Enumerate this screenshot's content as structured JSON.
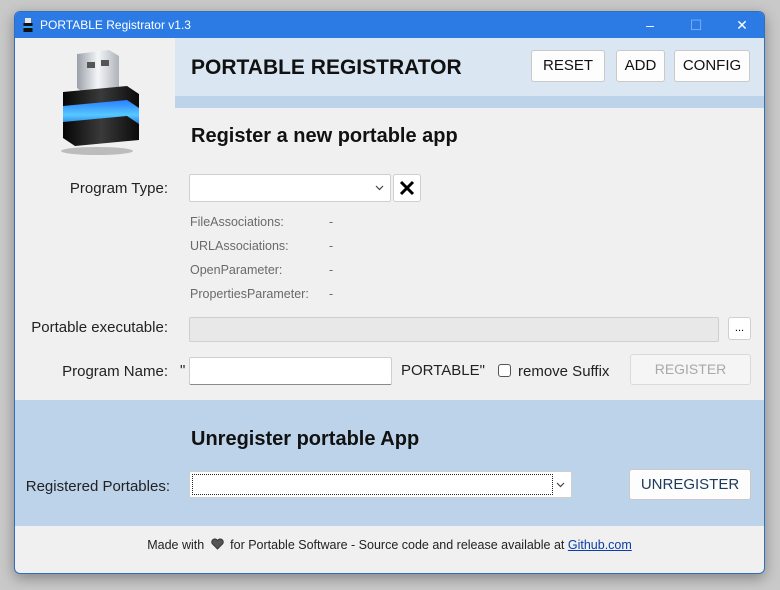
{
  "window": {
    "title": "PORTABLE Registrator v1.3",
    "controls": {
      "minimize": "–",
      "maximize": "☐",
      "close": "✕"
    }
  },
  "header": {
    "title": "PORTABLE REGISTRATOR",
    "buttons": {
      "reset": "RESET",
      "add": "ADD",
      "config": "CONFIG"
    }
  },
  "register": {
    "title": "Register a new portable app",
    "program_type": {
      "label": "Program Type:",
      "selected": ""
    },
    "associations": [
      {
        "key": "FileAssociations:",
        "value": "-"
      },
      {
        "key": "URLAssociations:",
        "value": "-"
      },
      {
        "key": "OpenParameter:",
        "value": "-"
      },
      {
        "key": "PropertiesParameter:",
        "value": "-"
      }
    ],
    "executable": {
      "label": "Portable executable:",
      "value": "",
      "browse": "..."
    },
    "program_name": {
      "label": "Program Name:",
      "open_quote": "\"",
      "value": "",
      "suffix": "PORTABLE\"",
      "remove_suffix_label": "remove Suffix",
      "remove_suffix_checked": false
    },
    "register_button": "REGISTER"
  },
  "unregister": {
    "title": "Unregister portable App",
    "label": "Registered Portables:",
    "selected": "",
    "button": "UNREGISTER"
  },
  "footer": {
    "prefix": "Made with",
    "middle": "for Portable Software - Source code and release available at",
    "link": "Github.com"
  },
  "colors": {
    "titlebar": "#2c7be5",
    "header_band": "#dae6f2",
    "unregister_band": "#bcd3ea",
    "link": "#0a3ea8"
  },
  "icons": {
    "app": "usb-stick-icon",
    "clear": "x-icon",
    "dropdown": "chevron-down-icon",
    "heart": "heart-icon"
  }
}
